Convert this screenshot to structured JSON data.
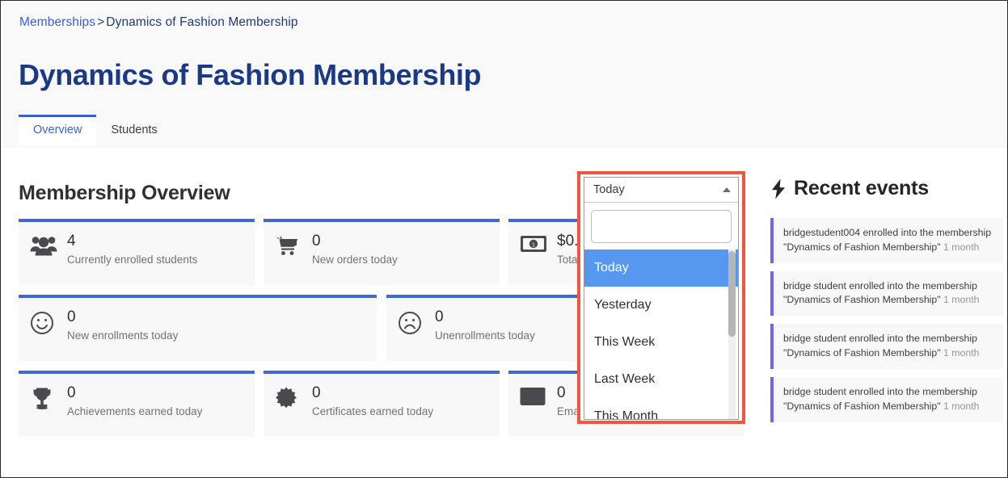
{
  "breadcrumb": {
    "parent": "Memberships",
    "separator": ">",
    "current": "Dynamics of Fashion Membership"
  },
  "page_title": "Dynamics of Fashion Membership",
  "tabs": [
    {
      "label": "Overview",
      "active": true
    },
    {
      "label": "Students",
      "active": false
    }
  ],
  "main": {
    "section_title": "Membership Overview",
    "cards": [
      [
        {
          "icon": "people-icon",
          "value": "4",
          "label": "Currently enrolled students"
        },
        {
          "icon": "shopping-cart-icon",
          "value": "0",
          "label": "New orders today"
        },
        {
          "icon": "banknote-icon",
          "value": "$0.",
          "label": "Tota"
        }
      ],
      [
        {
          "icon": "smiley-face-icon",
          "value": "0",
          "label": "New enrollments today"
        },
        {
          "icon": "sad-face-icon",
          "value": "0",
          "label": "Unenrollments today"
        }
      ],
      [
        {
          "icon": "trophy-icon",
          "value": "0",
          "label": "Achievements earned today"
        },
        {
          "icon": "certificate-badge-icon",
          "value": "0",
          "label": "Certificates earned today"
        },
        {
          "icon": "envelope-icon",
          "value": "0",
          "label": "Emails sent today"
        }
      ]
    ]
  },
  "period_dropdown": {
    "selected_label": "Today",
    "search_value": "",
    "search_placeholder": "",
    "caret_icon": "chevron-up-icon",
    "options": [
      {
        "label": "Today",
        "selected": true
      },
      {
        "label": "Yesterday",
        "selected": false
      },
      {
        "label": "This Week",
        "selected": false
      },
      {
        "label": "Last Week",
        "selected": false
      },
      {
        "label": "This Month",
        "selected": false
      }
    ]
  },
  "events": {
    "icon": "lightning-bolt-icon",
    "title": "Recent events",
    "items": [
      {
        "text": "bridgestudent004 enrolled into the membership \"Dynamics of Fashion Membership\"",
        "ago": "1 month"
      },
      {
        "text": "bridge student enrolled into the membership \"Dynamics of Fashion Membership\"",
        "ago": "1 month"
      },
      {
        "text": "bridge student enrolled into the membership \"Dynamics of Fashion Membership\"",
        "ago": "1 month"
      },
      {
        "text": "bridge student enrolled into the membership \"Dynamics of Fashion Membership\"",
        "ago": "1 month"
      }
    ]
  },
  "colors": {
    "brand_blue": "#3b5fd0",
    "card_accent": "#4168d0",
    "title_blue": "#1b3a86",
    "event_accent": "#7b61f0",
    "highlight_red": "#f1563c",
    "option_selected": "#5698ef"
  }
}
